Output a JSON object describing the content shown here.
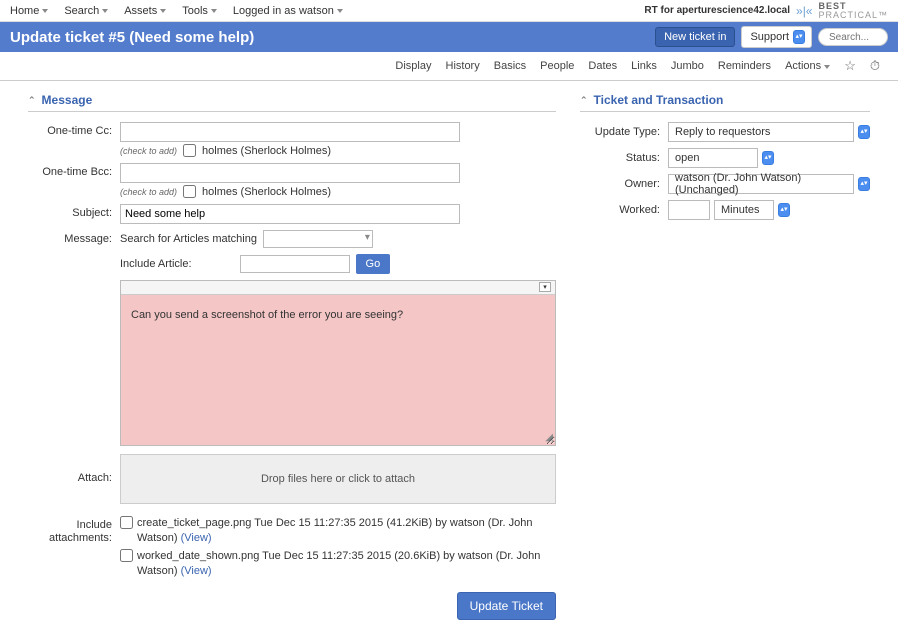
{
  "topnav": {
    "home": "Home",
    "search": "Search",
    "assets": "Assets",
    "tools": "Tools",
    "logged_in": "Logged in as watson",
    "rt_for": "RT for aperturescience42.local",
    "logo_l1": "BEST",
    "logo_l2": "PRACTICAL"
  },
  "titlebar": {
    "title": "Update ticket #5 (Need some help)",
    "new_ticket": "New ticket in",
    "support": "Support",
    "search_ph": "Search..."
  },
  "tabs": {
    "display": "Display",
    "history": "History",
    "basics": "Basics",
    "people": "People",
    "dates": "Dates",
    "links": "Links",
    "jumbo": "Jumbo",
    "reminders": "Reminders",
    "actions": "Actions"
  },
  "message": {
    "heading": "Message",
    "one_time_cc": "One-time Cc:",
    "one_time_bcc": "One-time Bcc:",
    "check_to_add": "(check to add)",
    "holmes": "holmes (Sherlock Holmes)",
    "subject_lbl": "Subject:",
    "subject_val": "Need some help",
    "message_lbl": "Message:",
    "search_articles": "Search for Articles matching",
    "include_article": "Include Article:",
    "go": "Go",
    "body": "Can you send a screenshot of the error you are seeing?",
    "attach_lbl": "Attach:",
    "drop_files": "Drop files here or click to attach",
    "include_attach_lbl": "Include attachments:",
    "attach1": "create_ticket_page.png Tue Dec 15 11:27:35 2015 (41.2KiB) by watson (Dr. John Watson)",
    "attach2": "worked_date_shown.png Tue Dec 15 11:27:35 2015 (20.6KiB) by watson (Dr. John Watson)",
    "view": "(View)",
    "submit": "Update Ticket"
  },
  "txn": {
    "heading": "Ticket and Transaction",
    "update_type_lbl": "Update Type:",
    "update_type_val": "Reply to requestors",
    "status_lbl": "Status:",
    "status_val": "open",
    "owner_lbl": "Owner:",
    "owner_val": "watson (Dr. John Watson) (Unchanged)",
    "worked_lbl": "Worked:",
    "worked_unit": "Minutes"
  }
}
